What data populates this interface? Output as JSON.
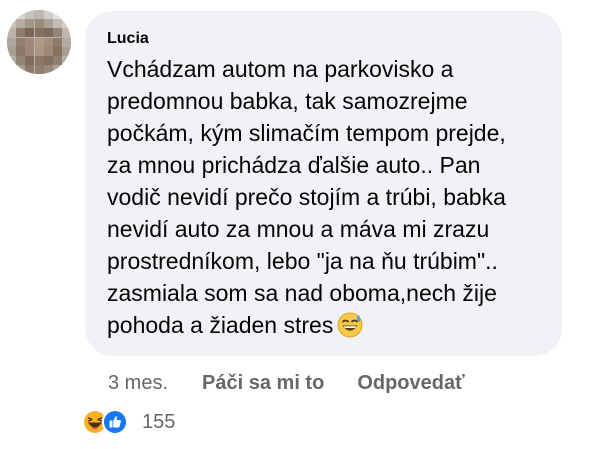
{
  "comment": {
    "author": "Lucia",
    "text_lines": [
      "Vchádzam autom na parkovisko a",
      "predomnou babka, tak samozrejme",
      "počkám, kým slimačím tempom prejde,",
      "za mnou prichádza ďalšie auto.. Pan",
      "vodič nevidí prečo stojím a trúbi, babka",
      "nevidí auto za mnou a máva mi zrazu",
      "prostredníkom, lebo \"ja na ňu trúbim\"..",
      "zasmiala som sa nad oboma,nech žije",
      "pohoda a žiaden stres"
    ],
    "emoji": "grinning-sweat-emoji"
  },
  "actions": {
    "time": "3 mes.",
    "like_label": "Páči sa mi to",
    "reply_label": "Odpovedať"
  },
  "reactions": {
    "icons": [
      "haha-reaction-icon",
      "like-reaction-icon"
    ],
    "count": "155"
  },
  "colors": {
    "bubble_bg": "#f0f2f5",
    "text": "#050505",
    "secondary_text": "#65676b",
    "like_blue": "#1877f2",
    "haha_yellow": "#f7b125"
  }
}
